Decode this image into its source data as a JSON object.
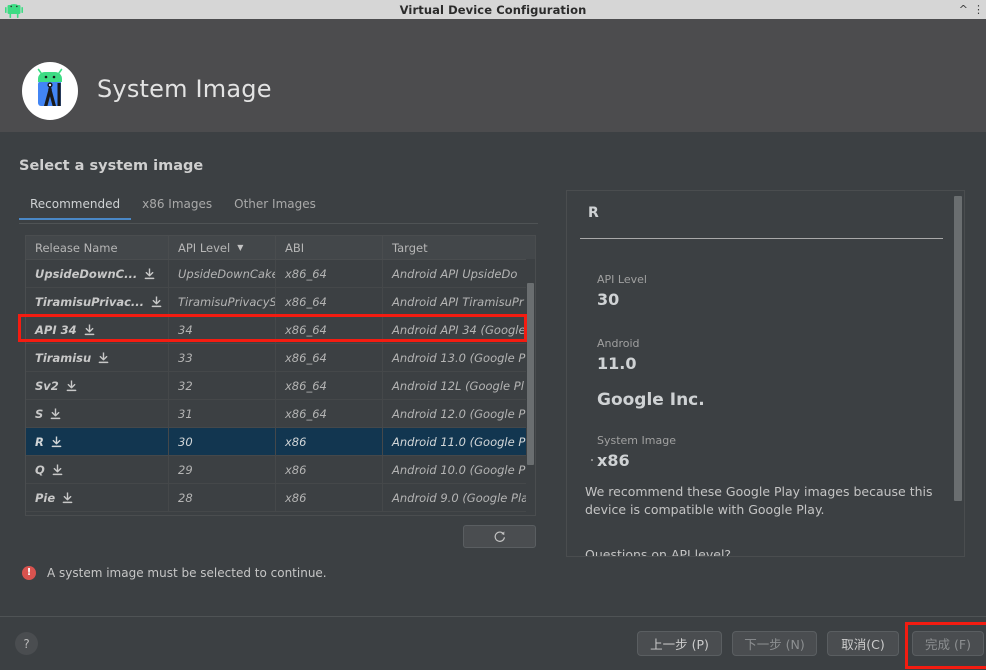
{
  "window": {
    "title": "Virtual Device Configuration",
    "app_icon": "android-robot-icon",
    "collapse_icon": "chevron-up-icon",
    "menu_icon": "vertical-dots-icon"
  },
  "header": {
    "logo": "android-studio-logo",
    "title": "System Image"
  },
  "main": {
    "section_title": "Select a system image",
    "tabs": [
      {
        "label": "Recommended",
        "active": true
      },
      {
        "label": "x86 Images",
        "active": false
      },
      {
        "label": "Other Images",
        "active": false
      }
    ],
    "table": {
      "columns": [
        "Release Name",
        "API Level",
        "ABI",
        "Target"
      ],
      "sorted_column": "API Level",
      "sort_caret": "▼",
      "download_icon": "download-icon",
      "rows": [
        {
          "release_name": "UpsideDownC...",
          "api_level": "UpsideDownCake",
          "abi": "x86_64",
          "target": "Android API UpsideDo",
          "downloadable": true,
          "selected": false
        },
        {
          "release_name": "TiramisuPrivac...",
          "api_level": "TiramisuPrivacySa",
          "abi": "x86_64",
          "target": "Android API TiramisuPr",
          "downloadable": true,
          "selected": false
        },
        {
          "release_name": "API 34",
          "api_level": "34",
          "abi": "x86_64",
          "target": "Android API 34 (Google",
          "downloadable": true,
          "selected": false
        },
        {
          "release_name": "Tiramisu",
          "api_level": "33",
          "abi": "x86_64",
          "target": "Android 13.0 (Google P",
          "downloadable": true,
          "selected": false
        },
        {
          "release_name": "Sv2",
          "api_level": "32",
          "abi": "x86_64",
          "target": "Android 12L (Google Pl",
          "downloadable": true,
          "selected": false
        },
        {
          "release_name": "S",
          "api_level": "31",
          "abi": "x86_64",
          "target": "Android 12.0 (Google P",
          "downloadable": true,
          "selected": false
        },
        {
          "release_name": "R",
          "api_level": "30",
          "abi": "x86",
          "target": "Android 11.0 (Google P",
          "downloadable": true,
          "selected": true
        },
        {
          "release_name": "Q",
          "api_level": "29",
          "abi": "x86",
          "target": "Android 10.0 (Google P",
          "downloadable": true,
          "selected": false
        },
        {
          "release_name": "Pie",
          "api_level": "28",
          "abi": "x86",
          "target": "Android 9.0 (Google Pla",
          "downloadable": true,
          "selected": false
        }
      ]
    },
    "refresh_button": {
      "icon": "refresh-icon",
      "label": "⟳"
    },
    "error": {
      "icon": "error-icon",
      "icon_glyph": "!",
      "message": "A system image must be selected to continue."
    }
  },
  "detail_panel": {
    "title": "R",
    "api_level_label": "API Level",
    "api_level_value": "30",
    "android_label": "Android",
    "android_value": "11.0",
    "vendor": "Google Inc.",
    "system_image_label": "System Image",
    "system_image_value": "x86",
    "recommendation": "We recommend these Google Play images because this device is compatible with Google Play.",
    "questions_line": "Questions on API level?"
  },
  "footer": {
    "help_label": "?",
    "buttons": [
      {
        "label": "上一步 (P)",
        "name": "previous",
        "disabled": false
      },
      {
        "label": "下一步 (N)",
        "name": "next",
        "disabled": true
      },
      {
        "label": "取消(C)",
        "name": "cancel",
        "disabled": false
      },
      {
        "label": "完成 (F)",
        "name": "finish",
        "disabled": true
      }
    ]
  },
  "annotations": {
    "highlight_color": "#f41c11",
    "boxes": [
      "api-34-row",
      "finish-button"
    ]
  },
  "colors": {
    "titlebar_bg": "#d6d6d6",
    "header_bg": "#4c4c4e",
    "body_bg": "#3c4043",
    "selection_bg": "#123650",
    "tab_accent": "#4a88c7",
    "error_red": "#d9534f",
    "annotation_red": "#f41c11"
  }
}
